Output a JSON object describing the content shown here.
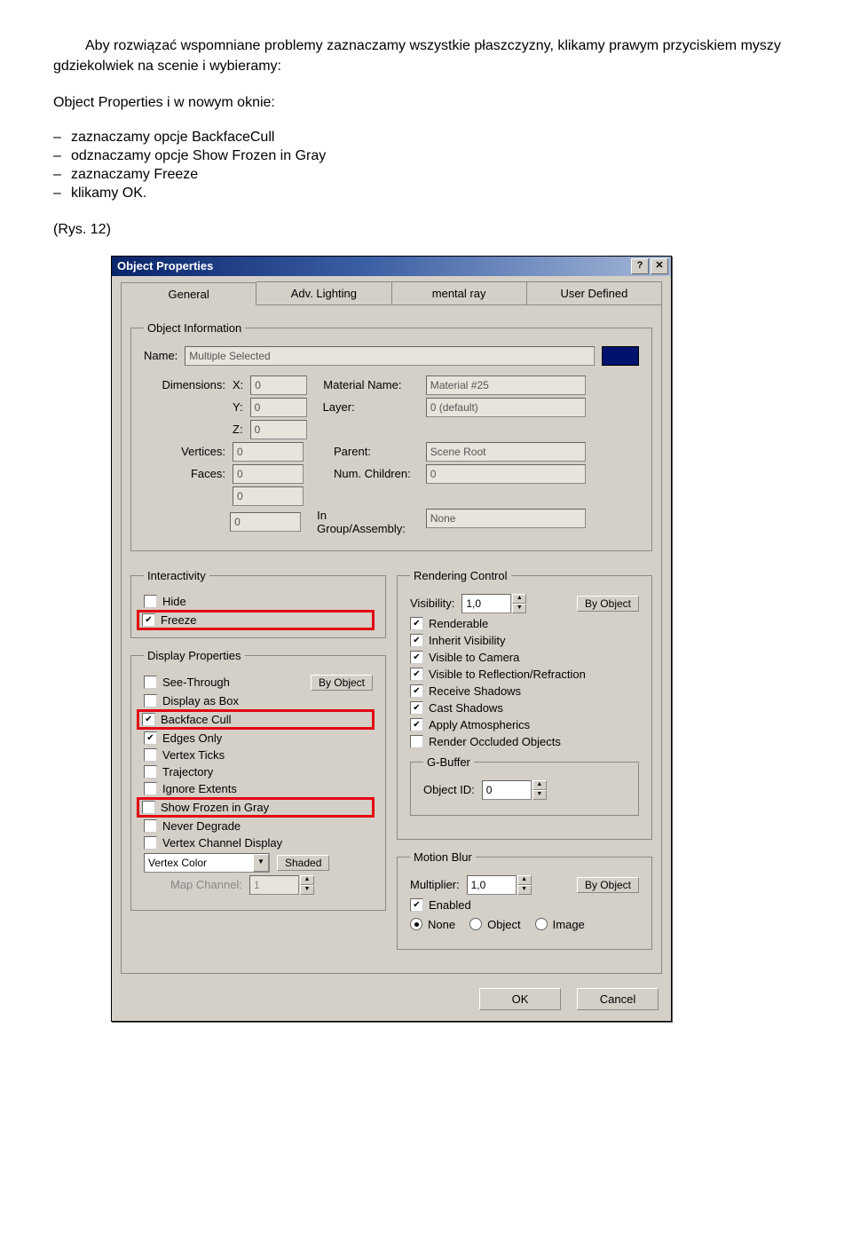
{
  "intro": {
    "p1": "Aby rozwiązać wspomniane problemy zaznaczamy wszystkie płaszczyzny, klikamy prawym przyciskiem myszy gdziekolwiek na scenie i wybieramy:",
    "p2": "Object Properties i w nowym oknie:",
    "bullets": [
      "zaznaczamy opcje BackfaceCull",
      "odznaczamy opcje Show Frozen in Gray",
      "zaznaczamy Freeze",
      "klikamy OK."
    ],
    "figref": "(Rys. 12)"
  },
  "dialog": {
    "title": "Object Properties",
    "help_glyph": "?",
    "close_glyph": "✕",
    "tabs": [
      "General",
      "Adv. Lighting",
      "mental ray",
      "User Defined"
    ],
    "objinfo": {
      "legend": "Object Information",
      "name_label": "Name:",
      "name_value": "Multiple Selected",
      "dimensions_label": "Dimensions:",
      "x_label": "X:",
      "x_val": "0",
      "y_label": "Y:",
      "y_val": "0",
      "z_label": "Z:",
      "z_val": "0",
      "vertices_label": "Vertices:",
      "vertices_val": "0",
      "faces_label": "Faces:",
      "faces_val": "0",
      "extra1_val": "0",
      "extra2_val": "0",
      "matname_label": "Material Name:",
      "matname_val": "Material #25",
      "layer_label": "Layer:",
      "layer_val": "0 (default)",
      "parent_label": "Parent:",
      "parent_val": "Scene Root",
      "numchildren_label": "Num. Children:",
      "numchildren_val": "0",
      "ingroup_label": "In Group/Assembly:",
      "ingroup_val": "None"
    },
    "interactivity": {
      "legend": "Interactivity",
      "hide": "Hide",
      "freeze": "Freeze"
    },
    "display": {
      "legend": "Display Properties",
      "see_through": "See-Through",
      "display_as_box": "Display as Box",
      "backface_cull": "Backface Cull",
      "edges_only": "Edges Only",
      "vertex_ticks": "Vertex Ticks",
      "trajectory": "Trajectory",
      "ignore_extents": "Ignore Extents",
      "show_frozen": "Show Frozen in Gray",
      "never_degrade": "Never Degrade",
      "vertex_channel": "Vertex Channel Display",
      "vertex_color_sel": "Vertex Color",
      "shaded_btn": "Shaded",
      "map_channel_label": "Map Channel:",
      "map_channel_val": "1",
      "by_object": "By Object"
    },
    "rendering": {
      "legend": "Rendering Control",
      "visibility_label": "Visibility:",
      "visibility_val": "1,0",
      "by_object": "By Object",
      "renderable": "Renderable",
      "inherit_vis": "Inherit Visibility",
      "visible_camera": "Visible to Camera",
      "visible_refl": "Visible to Reflection/Refraction",
      "receive_shadows": "Receive Shadows",
      "cast_shadows": "Cast Shadows",
      "apply_atmos": "Apply Atmospherics",
      "render_occluded": "Render Occluded Objects"
    },
    "gbuffer": {
      "legend": "G-Buffer",
      "objid_label": "Object ID:",
      "objid_val": "0"
    },
    "motionblur": {
      "legend": "Motion Blur",
      "multiplier_label": "Multiplier:",
      "multiplier_val": "1,0",
      "by_object": "By Object",
      "enabled": "Enabled",
      "none": "None",
      "object": "Object",
      "image": "Image"
    },
    "footer": {
      "ok": "OK",
      "cancel": "Cancel"
    }
  }
}
